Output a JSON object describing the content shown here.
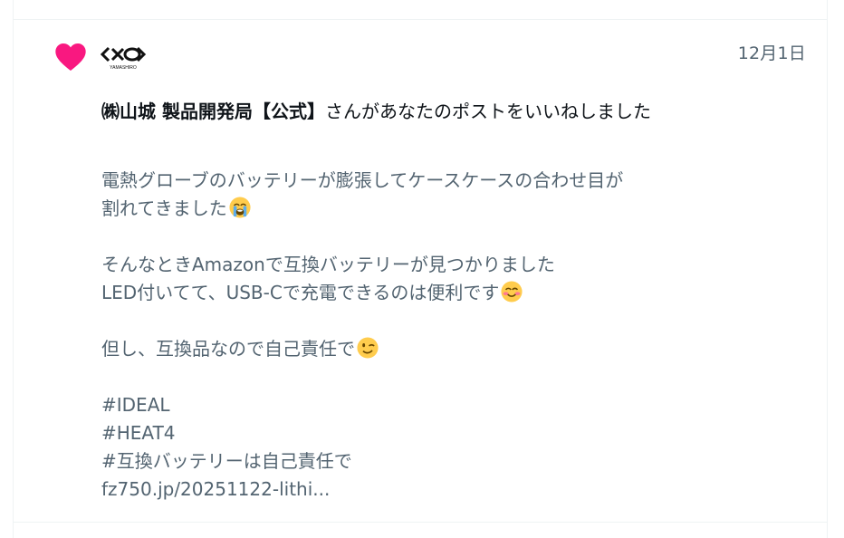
{
  "notification": {
    "timestamp": "12月1日",
    "account_name": "㈱山城 製品開発局【公式】",
    "action_text": "さんがあなたのポストをいいねしました",
    "avatar_logo": "YAMASHIRO",
    "post": {
      "line1": "電熱グローブのバッテリーが膨張してケースケースの合わせ目が",
      "line2": "割れてきました",
      "line3": "そんなときAmazonで互換バッテリーが見つかりました",
      "line4": "LED付いてて、USB-Cで充電できるのは便利です",
      "line5": "但し、互換品なので自己責任で",
      "hashtag1": "#IDEAL",
      "hashtag2": "#HEAT4",
      "hashtag3": "#互換バッテリーは自己責任で",
      "link": "fz750.jp/20251122-lithi..."
    }
  },
  "icons": {
    "like": "heart-icon",
    "emoji_1": "loudly-crying-face-emoji",
    "emoji_2": "smiling-face-with-smiling-eyes-emoji",
    "emoji_3": "winking-face-emoji"
  },
  "colors": {
    "heart": "#f91880",
    "primary_text": "#0f1419",
    "secondary_text": "#536471",
    "divider": "#eff3f4"
  }
}
